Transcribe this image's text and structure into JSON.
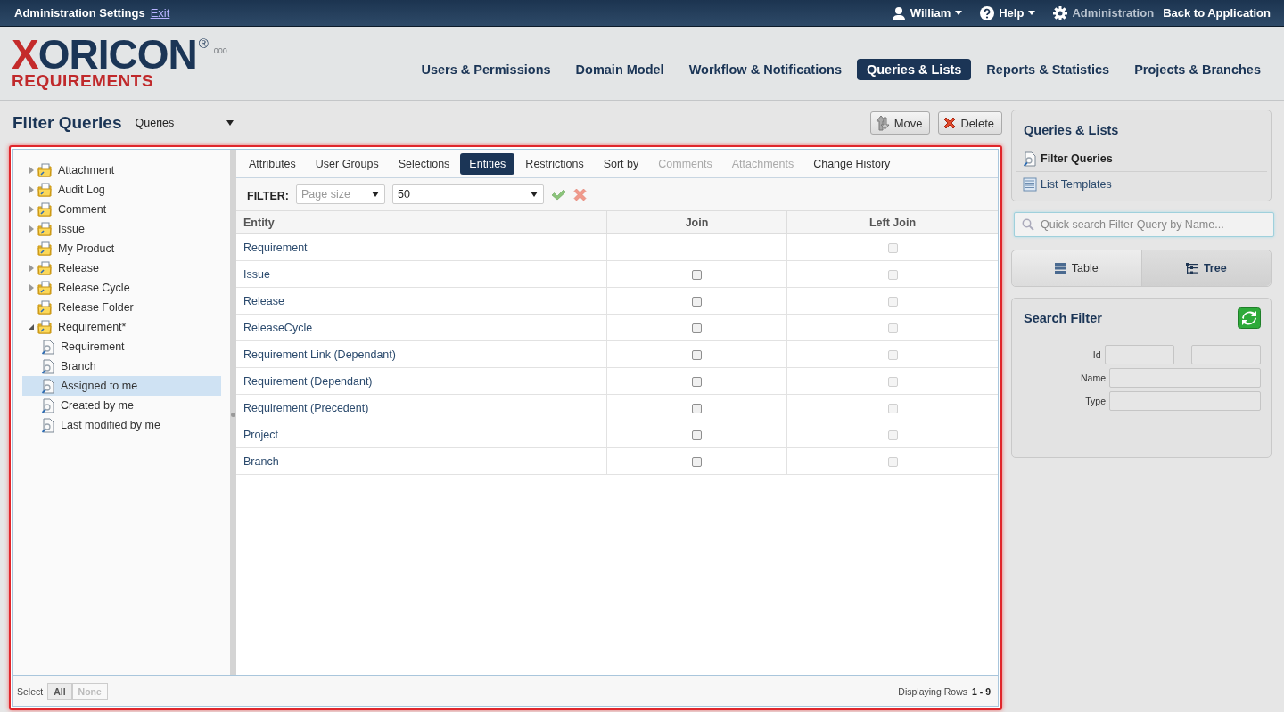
{
  "top_bar": {
    "title": "Administration Settings",
    "exit_link": "Exit",
    "user": "William",
    "help": "Help",
    "administration": "Administration",
    "back_link": "Back to Application"
  },
  "logo": {
    "brand": "XORICON",
    "registered": "®",
    "subtitle": "REQUIREMENTS",
    "version": "000"
  },
  "nav": [
    {
      "label": "Users & Permissions",
      "selected": false
    },
    {
      "label": "Domain Model",
      "selected": false
    },
    {
      "label": "Workflow & Notifications",
      "selected": false
    },
    {
      "label": "Queries & Lists",
      "selected": true
    },
    {
      "label": "Reports & Statistics",
      "selected": false
    },
    {
      "label": "Projects & Branches",
      "selected": false
    }
  ],
  "page": {
    "title": "Filter Queries",
    "dropdown": "Queries",
    "move_button": "Move",
    "delete_button": "Delete"
  },
  "tree": [
    {
      "label": "Attachment",
      "kind": "folder",
      "expandable": true,
      "expanded": false,
      "selected": false
    },
    {
      "label": "Audit Log",
      "kind": "folder",
      "expandable": true,
      "expanded": false,
      "selected": false
    },
    {
      "label": "Comment",
      "kind": "folder",
      "expandable": true,
      "expanded": false,
      "selected": false
    },
    {
      "label": "Issue",
      "kind": "folder",
      "expandable": true,
      "expanded": false,
      "selected": false
    },
    {
      "label": "My Product",
      "kind": "folder",
      "expandable": false,
      "selected": false
    },
    {
      "label": "Release",
      "kind": "folder",
      "expandable": true,
      "expanded": false,
      "selected": false
    },
    {
      "label": "Release Cycle",
      "kind": "folder",
      "expandable": true,
      "expanded": false,
      "selected": false
    },
    {
      "label": "Release Folder",
      "kind": "folder",
      "expandable": false,
      "selected": false
    },
    {
      "label": "Requirement*",
      "kind": "folder",
      "expandable": true,
      "expanded": true,
      "selected": false,
      "children": [
        {
          "label": "Requirement",
          "kind": "query",
          "selected": false
        },
        {
          "label": "Branch",
          "kind": "query",
          "selected": false
        },
        {
          "label": "Assigned to me",
          "kind": "query",
          "selected": true
        },
        {
          "label": "Created by me",
          "kind": "query",
          "selected": false
        },
        {
          "label": "Last modified by me",
          "kind": "query",
          "selected": false
        }
      ]
    }
  ],
  "tabs": [
    {
      "label": "Attributes",
      "selected": false,
      "disabled": false
    },
    {
      "label": "User Groups",
      "selected": false,
      "disabled": false
    },
    {
      "label": "Selections",
      "selected": false,
      "disabled": false
    },
    {
      "label": "Entities",
      "selected": true,
      "disabled": false
    },
    {
      "label": "Restrictions",
      "selected": false,
      "disabled": false
    },
    {
      "label": "Sort by",
      "selected": false,
      "disabled": false
    },
    {
      "label": "Comments",
      "selected": false,
      "disabled": true
    },
    {
      "label": "Attachments",
      "selected": false,
      "disabled": true
    },
    {
      "label": "Change History",
      "selected": false,
      "disabled": false
    }
  ],
  "filter": {
    "label": "FILTER:",
    "field_placeholder": "Page size",
    "value": "50"
  },
  "table": {
    "columns": [
      "Entity",
      "Join",
      "Left Join"
    ],
    "rows": [
      {
        "entity": "Requirement",
        "has_join": false,
        "left_join_checked": false,
        "left_join_disabled": true
      },
      {
        "entity": "Issue",
        "has_join": true,
        "join_checked": false,
        "left_join_checked": false,
        "left_join_disabled": true
      },
      {
        "entity": "Release",
        "has_join": true,
        "join_checked": false,
        "left_join_checked": false,
        "left_join_disabled": true
      },
      {
        "entity": "ReleaseCycle",
        "has_join": true,
        "join_checked": false,
        "left_join_checked": false,
        "left_join_disabled": true
      },
      {
        "entity": "Requirement Link (Dependant)",
        "has_join": true,
        "join_checked": false,
        "left_join_checked": false,
        "left_join_disabled": true
      },
      {
        "entity": "Requirement (Dependant)",
        "has_join": true,
        "join_checked": false,
        "left_join_checked": false,
        "left_join_disabled": true
      },
      {
        "entity": "Requirement (Precedent)",
        "has_join": true,
        "join_checked": false,
        "left_join_checked": false,
        "left_join_disabled": true
      },
      {
        "entity": "Project",
        "has_join": true,
        "join_checked": false,
        "left_join_checked": false,
        "left_join_disabled": true
      },
      {
        "entity": "Branch",
        "has_join": true,
        "join_checked": false,
        "left_join_checked": false,
        "left_join_disabled": true
      }
    ]
  },
  "footer": {
    "select_label": "Select",
    "all_button": "All",
    "none_button": "None",
    "none_disabled": true,
    "rows_label": "Displaying Rows",
    "rows_range": "1 - 9"
  },
  "sidebar": {
    "title": "Queries & Lists",
    "items": [
      {
        "label": "Filter Queries",
        "kind": "query",
        "selected": true
      },
      {
        "label": "List Templates",
        "kind": "list",
        "selected": false
      }
    ],
    "search_placeholder": "Quick search Filter Query by Name...",
    "view_toggle": [
      {
        "label": "Table",
        "kind": "table",
        "selected": false
      },
      {
        "label": "Tree",
        "kind": "tree",
        "selected": true
      }
    ],
    "search_filter": {
      "title": "Search Filter",
      "range_separator": "-",
      "fields": [
        {
          "label": "Id",
          "kind": "range"
        },
        {
          "label": "Name",
          "kind": "text"
        },
        {
          "label": "Type",
          "kind": "text"
        }
      ]
    }
  }
}
